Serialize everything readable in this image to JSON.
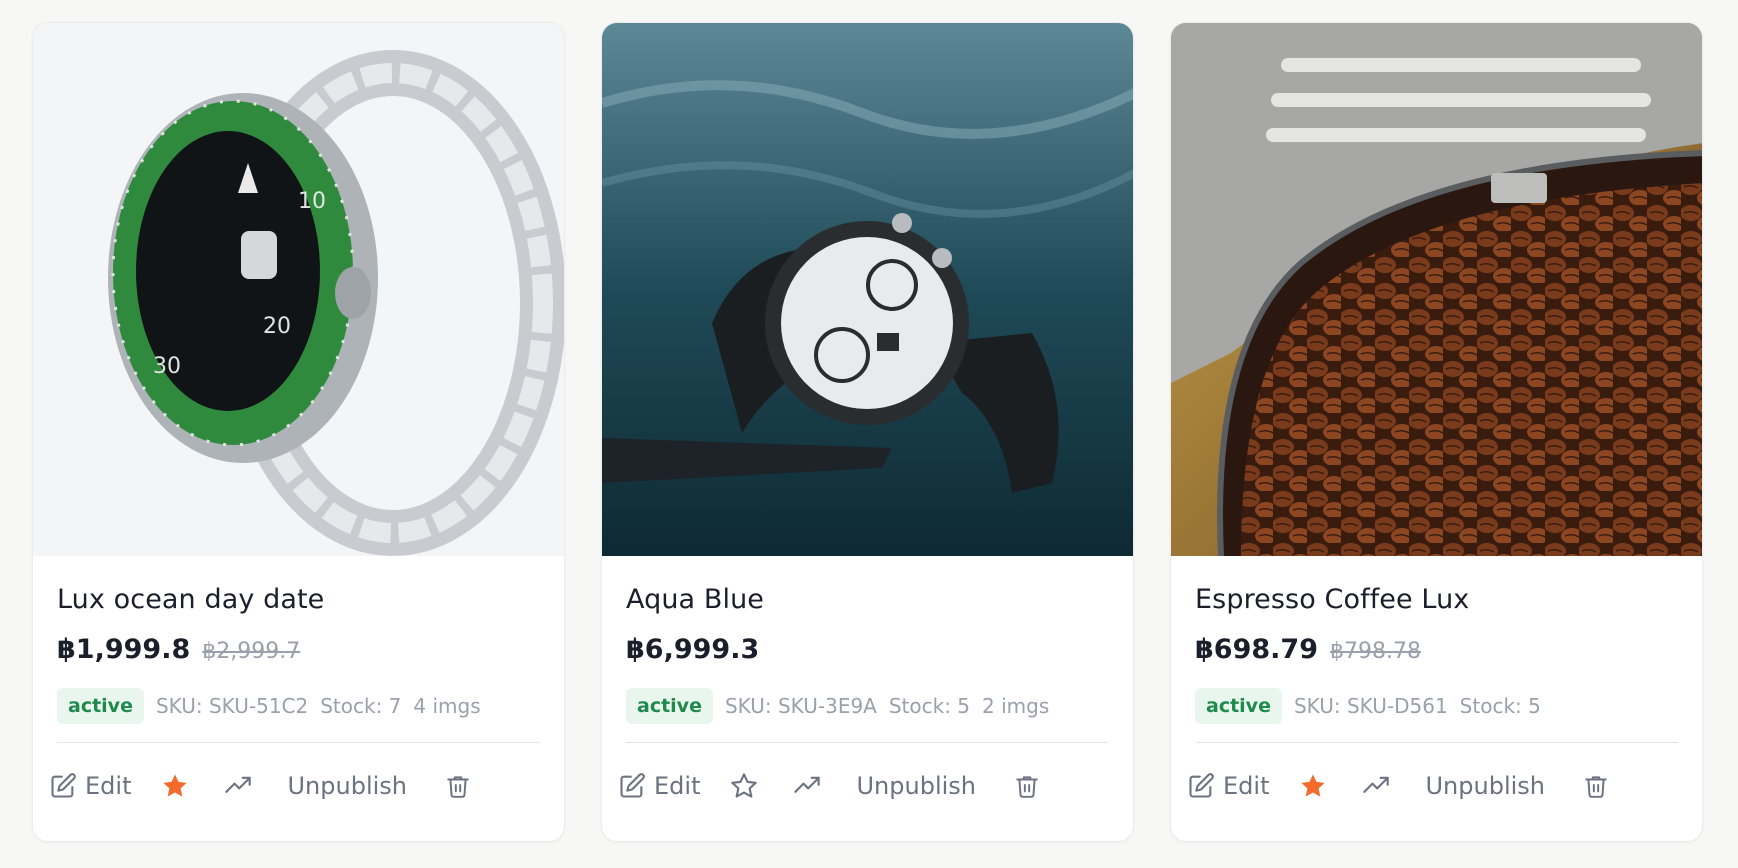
{
  "products": [
    {
      "title": "Lux ocean day date",
      "price": "฿1,999.8",
      "old_price": "฿2,999.7",
      "status": "active",
      "sku": "SKU: SKU-51C2",
      "stock": "Stock: 7",
      "images": "4 imgs",
      "featured": true,
      "image_subject": "green-bezel-dive-watch-photo"
    },
    {
      "title": "Aqua Blue",
      "price": "฿6,999.3",
      "old_price": "",
      "status": "active",
      "sku": "SKU: SKU-3E9A",
      "stock": "Stock: 5",
      "images": "2 imgs",
      "featured": false,
      "image_subject": "chronograph-watch-on-water-photo"
    },
    {
      "title": "Espresso Coffee Lux",
      "price": "฿698.79",
      "old_price": "฿798.78",
      "status": "active",
      "sku": "SKU: SKU-D561",
      "stock": "Stock: 5",
      "images": "",
      "featured": true,
      "image_subject": "coffee-beans-in-tin-photo"
    }
  ],
  "actions": {
    "edit_label": "Edit",
    "unpublish_label": "Unpublish"
  },
  "colors": {
    "accent_star": "#f26b2c",
    "badge_bg": "#e8f6ee",
    "badge_text": "#1f8a4c",
    "muted_text": "#9aa1ab"
  }
}
